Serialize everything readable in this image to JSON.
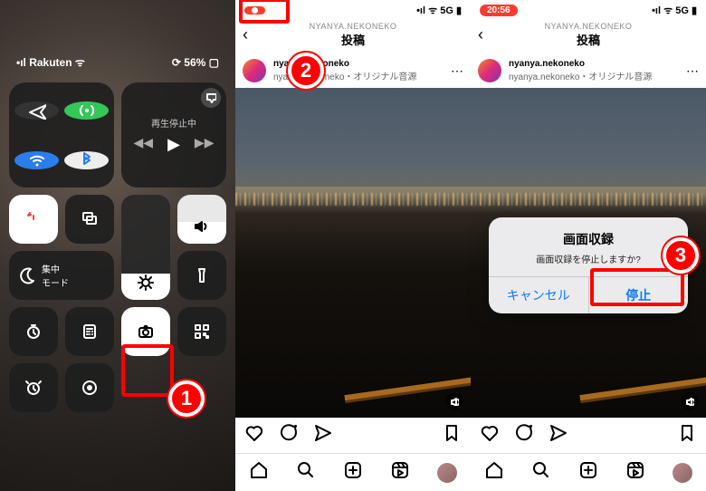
{
  "panel1": {
    "carrier": "Rakuten",
    "battery": "56%",
    "music_label": "再生停止中",
    "focus_label": "集中\nモード",
    "callout_number": "1"
  },
  "panel2": {
    "record_indicator_icon": "●",
    "signal_label": "5G",
    "header_username": "NYANYA.NEKONEKO",
    "header_title": "投稿",
    "post_user": "nyanya.nekoneko",
    "post_audio": "nyanya.nekoneko・オリジナル音源",
    "callout_number": "2"
  },
  "panel3": {
    "time": "20:56",
    "signal_label": "5G",
    "header_username": "NYANYA.NEKONEKO",
    "header_title": "投稿",
    "post_user": "nyanya.nekoneko",
    "post_audio": "nyanya.nekoneko・オリジナル音源",
    "dialog_title": "画面収録",
    "dialog_message": "画面収録を停止しますか?",
    "dialog_cancel": "キャンセル",
    "dialog_stop": "停止",
    "callout_number": "3"
  }
}
